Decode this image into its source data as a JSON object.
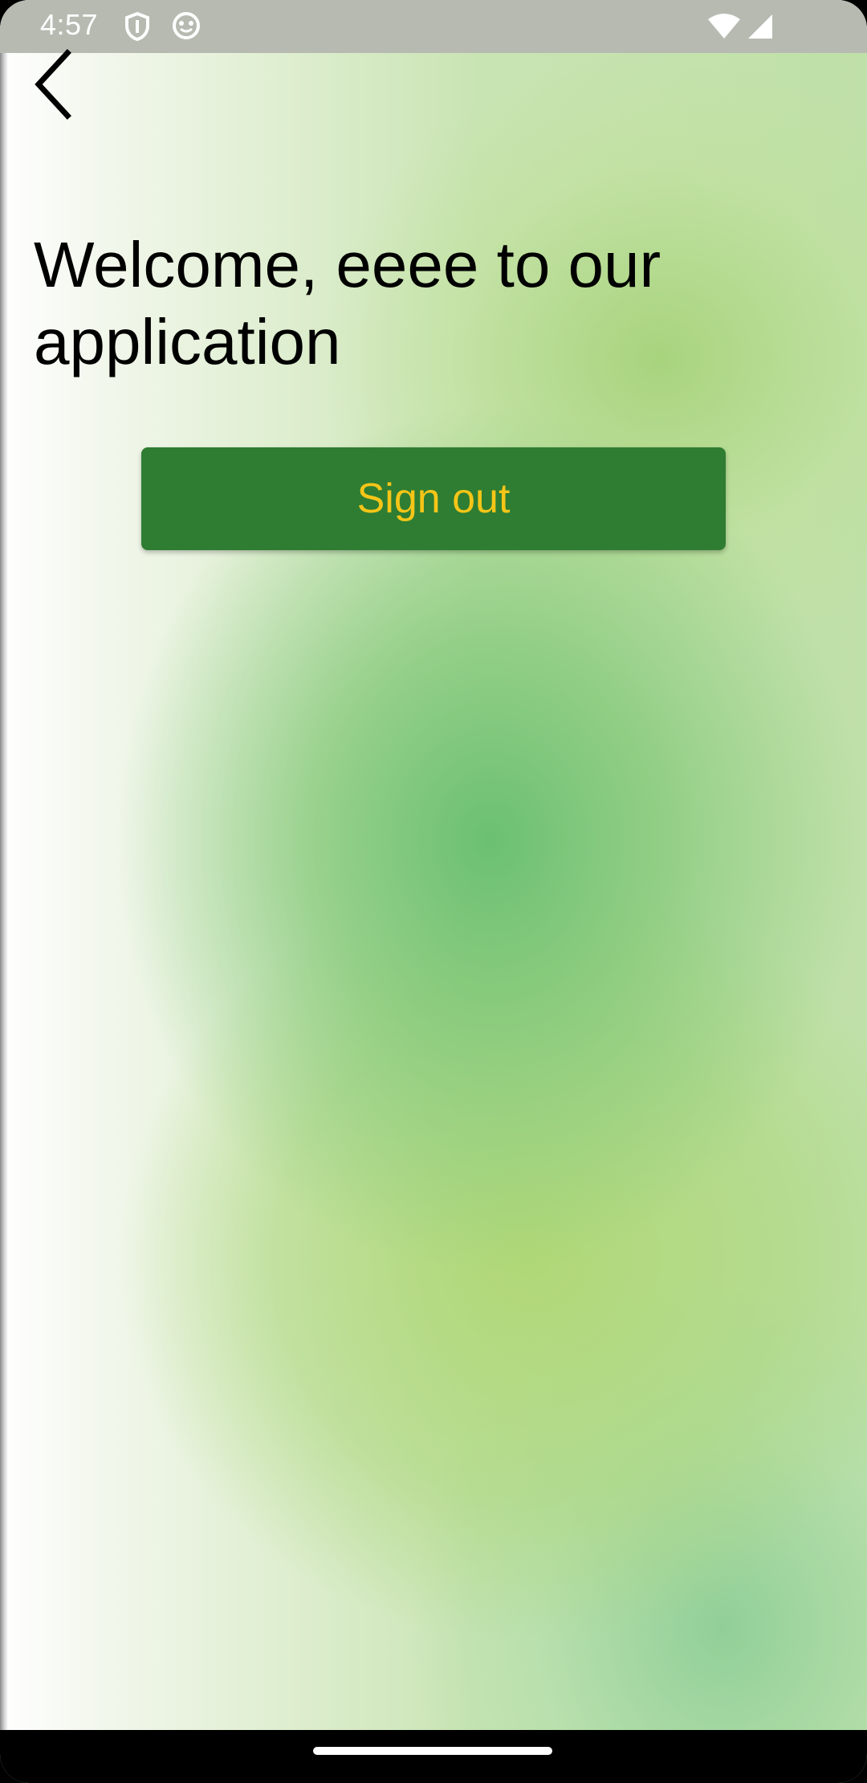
{
  "status_bar": {
    "time": "4:57",
    "icons": [
      "shield-icon",
      "face-icon",
      "wifi-icon",
      "cell-signal-icon"
    ]
  },
  "header": {
    "back_icon": "chevron-left-icon"
  },
  "main": {
    "welcome_text": "Welcome, eeee to our application",
    "sign_out_label": "Sign out"
  },
  "colors": {
    "button_bg": "#2e7d32",
    "button_text": "#f5c518",
    "status_bar_bg": "#b7bab1"
  }
}
